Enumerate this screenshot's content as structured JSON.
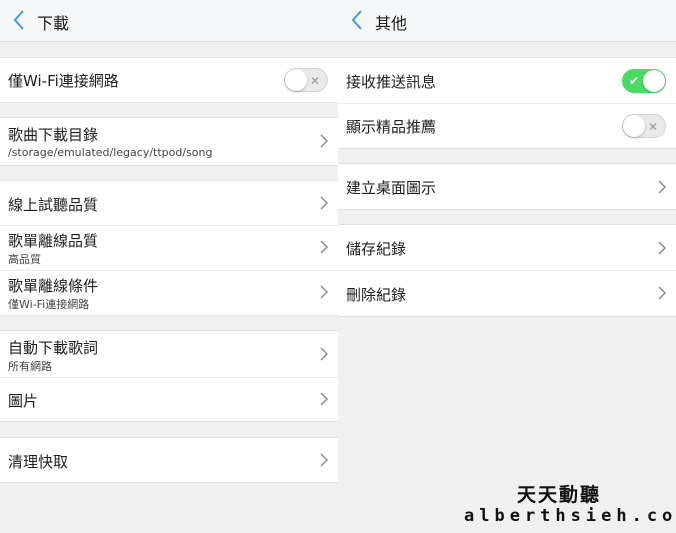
{
  "left": {
    "title": "下載",
    "rows": {
      "wifi_only": {
        "label": "僅Wi-Fi連接網路",
        "toggle": "off"
      },
      "download_dir": {
        "label": "歌曲下載目錄",
        "sub": "/storage/emulated/legacy/ttpod/song"
      },
      "online_quality": {
        "label": "線上試聽品質"
      },
      "offline_quality": {
        "label": "歌單離線品質",
        "sub": "高品質"
      },
      "offline_condition": {
        "label": "歌單離線條件",
        "sub": "僅Wi-Fi連接網路"
      },
      "auto_lyrics": {
        "label": "自動下載歌詞",
        "sub": "所有網路"
      },
      "pictures": {
        "label": "圖片"
      },
      "clear_cache": {
        "label": "清理快取"
      }
    }
  },
  "right": {
    "title": "其他",
    "rows": {
      "push": {
        "label": "接收推送訊息",
        "toggle": "on"
      },
      "recommend": {
        "label": "顯示精品推薦",
        "toggle": "off"
      },
      "shortcut": {
        "label": "建立桌面圖示"
      },
      "save_log": {
        "label": "儲存紀錄"
      },
      "delete_log": {
        "label": "刪除紀錄"
      }
    }
  },
  "watermark": {
    "line1": "天天動聽",
    "line2": "alberthsieh.com"
  },
  "colors": {
    "accent": "#3d9be0",
    "toggle_on": "#4cd964",
    "toggle_off": "#e9e9e9"
  }
}
